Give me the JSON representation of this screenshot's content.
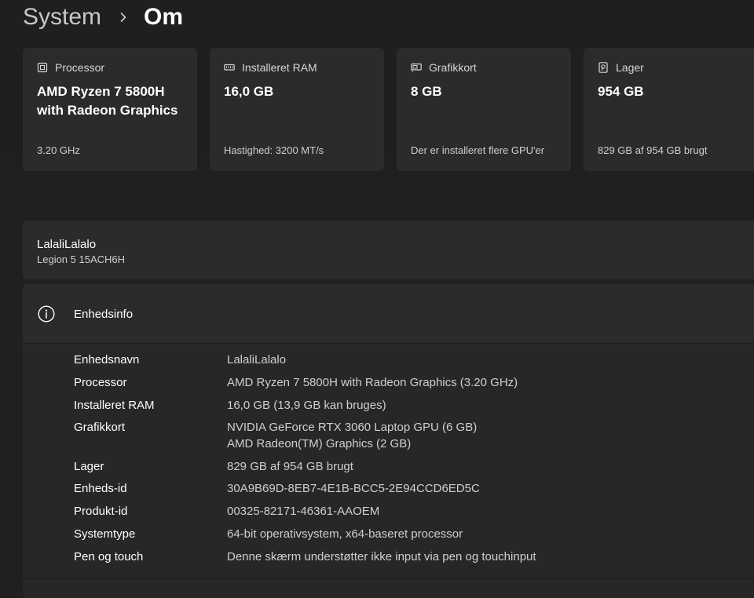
{
  "breadcrumb": {
    "parent": "System",
    "current": "Om"
  },
  "cards": [
    {
      "icon": "processor-icon",
      "title": "Processor",
      "value": "AMD Ryzen 7 5800H with Radeon Graphics",
      "sub": "3.20 GHz"
    },
    {
      "icon": "ram-icon",
      "title": "Installeret RAM",
      "value": "16,0 GB",
      "sub": "Hastighed: 3200 MT/s"
    },
    {
      "icon": "graphics-card-icon",
      "title": "Grafikkort",
      "value": "8 GB",
      "sub": "Der er installeret flere GPU'er"
    },
    {
      "icon": "storage-icon",
      "title": "Lager",
      "value": "954 GB",
      "sub": "829 GB af 954 GB brugt"
    }
  ],
  "device": {
    "name": "LalaliLalalo",
    "model": "Legion 5 15ACH6H"
  },
  "device_info": {
    "icon": "info-icon",
    "title": "Enhedsinfo",
    "rows": [
      {
        "label": "Enhedsnavn",
        "value": "LalaliLalalo"
      },
      {
        "label": "Processor",
        "value": "AMD Ryzen 7 5800H with Radeon Graphics (3.20 GHz)"
      },
      {
        "label": "Installeret RAM",
        "value": "16,0 GB (13,9 GB kan bruges)"
      },
      {
        "label": "Grafikkort",
        "value": "NVIDIA GeForce RTX 3060 Laptop GPU (6 GB)",
        "value2": "AMD Radeon(TM) Graphics (2 GB)"
      },
      {
        "label": "Lager",
        "value": "829 GB af 954 GB brugt"
      },
      {
        "label": "Enheds-id",
        "value": "30A9B69D-8EB7-4E1B-BCC5-2E94CCD6ED5C"
      },
      {
        "label": "Produkt-id",
        "value": "00325-82171-46361-AAOEM"
      },
      {
        "label": "Systemtype",
        "value": "64-bit operativsystem, x64-baseret processor"
      },
      {
        "label": "Pen og touch",
        "value": "Denne skærm understøtter ikke input via pen og touchinput"
      }
    ]
  }
}
